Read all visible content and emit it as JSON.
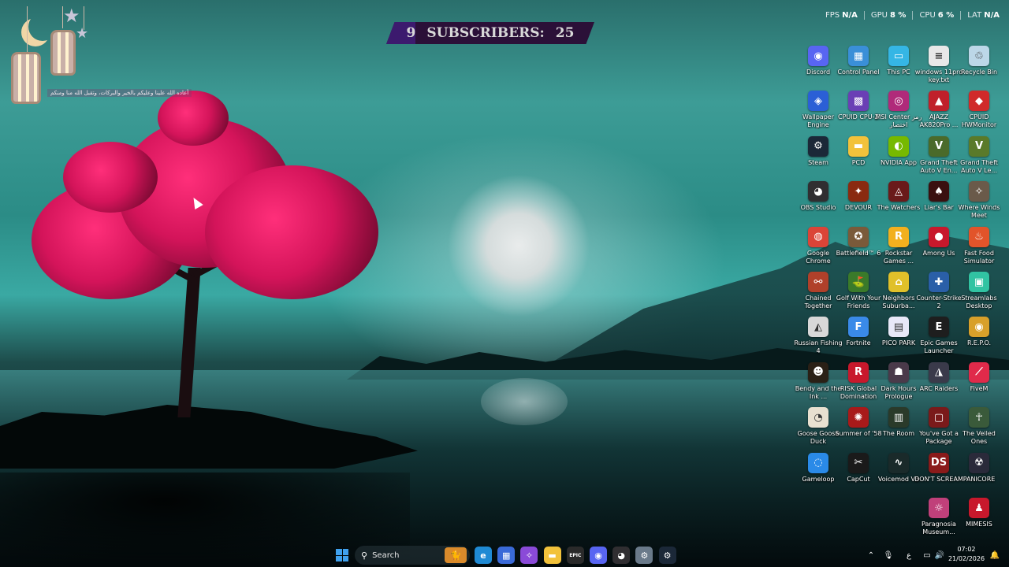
{
  "banner": {
    "count_left": "9",
    "label": "SUBSCRIBERS:",
    "count_right": "25"
  },
  "perf": [
    {
      "name": "FPS",
      "value": "N/A"
    },
    {
      "name": "GPU",
      "value": "8 %"
    },
    {
      "name": "CPU",
      "value": "6 %"
    },
    {
      "name": "LAT",
      "value": "N/A"
    }
  ],
  "decoration": {
    "arabic_text": "أعاده الله علينا وعليكم بالخير والبركات، وتقبل الله منا ومنكم"
  },
  "desktop_icons": [
    {
      "label": "Discord",
      "icon": "discord-icon",
      "color": "#5865f2",
      "glyph": "◉"
    },
    {
      "label": "Control Panel",
      "icon": "control-panel-icon",
      "color": "#3a8fd8",
      "glyph": "▦"
    },
    {
      "label": "This PC",
      "icon": "monitor-icon",
      "color": "#35b6e5",
      "glyph": "▭"
    },
    {
      "label": "windows 11pro key.txt",
      "icon": "text-file-icon",
      "color": "#e8e8e8",
      "glyph": "≡"
    },
    {
      "label": "Recycle Bin",
      "icon": "recycle-bin-icon",
      "color": "#bcd7e8",
      "glyph": "♲"
    },
    {
      "label": "Wallpaper Engine",
      "icon": "wallpaper-engine-icon",
      "color": "#2b5fd6",
      "glyph": "◈"
    },
    {
      "label": "CPUID CPU-Z",
      "icon": "cpuz-icon",
      "color": "#6a3fb5",
      "glyph": "▩"
    },
    {
      "label": "MSI Center رمز اختصار",
      "icon": "msi-center-icon",
      "color": "#b02a7a",
      "glyph": "◎"
    },
    {
      "label": "AJAZZ AK820Pro ...",
      "icon": "ajazz-icon",
      "color": "#c0202a",
      "glyph": "▲"
    },
    {
      "label": "CPUID HWMonitor",
      "icon": "hwmonitor-icon",
      "color": "#d02a2a",
      "glyph": "◆"
    },
    {
      "label": "Steam",
      "icon": "steam-icon",
      "color": "#1b2838",
      "glyph": "⚙"
    },
    {
      "label": "PCD",
      "icon": "folder-icon",
      "color": "#f2c23b",
      "glyph": "▬"
    },
    {
      "label": "NVIDIA App",
      "icon": "nvidia-icon",
      "color": "#76b900",
      "glyph": "◐"
    },
    {
      "label": "Grand Theft Auto V En...",
      "icon": "gta-icon",
      "color": "#4a6a2a",
      "glyph": "V"
    },
    {
      "label": "Grand Theft Auto V Le...",
      "icon": "gta-legacy-icon",
      "color": "#5a7a2a",
      "glyph": "V"
    },
    {
      "label": "OBS Studio",
      "icon": "obs-icon",
      "color": "#302e31",
      "glyph": "◕"
    },
    {
      "label": "DEVOUR",
      "icon": "devour-icon",
      "color": "#8a2a10",
      "glyph": "✦"
    },
    {
      "label": "The Watchers",
      "icon": "watchers-icon",
      "color": "#6a1a1a",
      "glyph": "◬"
    },
    {
      "label": "Liar's Bar",
      "icon": "liars-bar-icon",
      "color": "#3a1010",
      "glyph": "♠"
    },
    {
      "label": "Where Winds Meet",
      "icon": "where-winds-meet-icon",
      "color": "#6a5a4a",
      "glyph": "✧"
    },
    {
      "label": "Google Chrome",
      "icon": "chrome-icon",
      "color": "#db4437",
      "glyph": "◍"
    },
    {
      "label": "Battlefield™ 6",
      "icon": "battlefield-icon",
      "color": "#7a5a3a",
      "glyph": "✪"
    },
    {
      "label": "Rockstar Games ...",
      "icon": "rockstar-icon",
      "color": "#f2b01e",
      "glyph": "R"
    },
    {
      "label": "Among Us",
      "icon": "among-us-icon",
      "color": "#c8182c",
      "glyph": "●"
    },
    {
      "label": "Fast Food Simulator",
      "icon": "fast-food-icon",
      "color": "#e2542a",
      "glyph": "♨"
    },
    {
      "label": "Chained Together",
      "icon": "chained-together-icon",
      "color": "#b0402a",
      "glyph": "⚯"
    },
    {
      "label": "Golf With Your Friends",
      "icon": "golf-icon",
      "color": "#3a7a2a",
      "glyph": "⛳"
    },
    {
      "label": "Neighbors Suburba...",
      "icon": "neighbors-icon",
      "color": "#e0c02a",
      "glyph": "⌂"
    },
    {
      "label": "Counter-Strike 2",
      "icon": "counter-strike-icon",
      "color": "#2a5fa8",
      "glyph": "✚"
    },
    {
      "label": "Streamlabs Desktop",
      "icon": "streamlabs-icon",
      "color": "#31c3a2",
      "glyph": "▣"
    },
    {
      "label": "Russian Fishing 4",
      "icon": "russian-fishing-icon",
      "color": "#d8d8d8",
      "glyph": "◭"
    },
    {
      "label": "Fortnite",
      "icon": "fortnite-icon",
      "color": "#3a8ae8",
      "glyph": "F"
    },
    {
      "label": "PICO PARK",
      "icon": "pico-park-icon",
      "color": "#e8e8f8",
      "glyph": "▤"
    },
    {
      "label": "Epic Games Launcher",
      "icon": "epic-games-icon",
      "color": "#1e1e1e",
      "glyph": "E"
    },
    {
      "label": "R.E.P.O.",
      "icon": "repo-icon",
      "color": "#d8a02a",
      "glyph": "◉"
    },
    {
      "label": "Bendy and the Ink ...",
      "icon": "bendy-icon",
      "color": "#2a2016",
      "glyph": "☻"
    },
    {
      "label": "RISK Global Domination",
      "icon": "risk-icon",
      "color": "#c8182c",
      "glyph": "R"
    },
    {
      "label": "Dark Hours Prologue",
      "icon": "dark-hours-icon",
      "color": "#4a3a4a",
      "glyph": "☗"
    },
    {
      "label": "ARC Raiders",
      "icon": "arc-raiders-icon",
      "color": "#3a3a4a",
      "glyph": "◮"
    },
    {
      "label": "FiveM",
      "icon": "fivem-icon",
      "color": "#e02a4a",
      "glyph": "⟋"
    },
    {
      "label": "Goose Goose Duck",
      "icon": "goose-icon",
      "color": "#e8e0d0",
      "glyph": "◔"
    },
    {
      "label": "Summer of '58",
      "icon": "summer58-icon",
      "color": "#a81a1a",
      "glyph": "✺"
    },
    {
      "label": "The Room",
      "icon": "the-room-icon",
      "color": "#2a3a2a",
      "glyph": "▥"
    },
    {
      "label": "You've Got a Package",
      "icon": "package-icon",
      "color": "#7a1a1a",
      "glyph": "▢"
    },
    {
      "label": "The Veiled Ones",
      "icon": "veiled-ones-icon",
      "color": "#3a5a3a",
      "glyph": "☥"
    },
    {
      "label": "Gameloop",
      "icon": "gameloop-icon",
      "color": "#2a8ae8",
      "glyph": "◌"
    },
    {
      "label": "CapCut",
      "icon": "capcut-icon",
      "color": "#1a1a1a",
      "glyph": "✂"
    },
    {
      "label": "Voicemod V3",
      "icon": "voicemod-icon",
      "color": "#1a2a2a",
      "glyph": "∿"
    },
    {
      "label": "DON'T SCREAM",
      "icon": "dont-scream-icon",
      "color": "#8a1a1a",
      "glyph": "DS"
    },
    {
      "label": "PANICORE",
      "icon": "panicore-icon",
      "color": "#2a2a3a",
      "glyph": "☢"
    },
    {
      "label": "Paragnosia Museum...",
      "icon": "paragnosia-icon",
      "color": "#c0407a",
      "glyph": "☼"
    },
    {
      "label": "MIMESIS",
      "icon": "mimesis-icon",
      "color": "#c8182c",
      "glyph": "♟"
    }
  ],
  "taskbar": {
    "search_placeholder": "Search",
    "apps": [
      {
        "name": "edge-icon",
        "color": "#1f8ad4",
        "glyph": "e"
      },
      {
        "name": "store-icon",
        "color": "#3a6ad8",
        "glyph": "▦"
      },
      {
        "name": "copilot-icon",
        "color": "#8a4ad8",
        "glyph": "✧"
      },
      {
        "name": "file-explorer-icon",
        "color": "#f2c23b",
        "glyph": "▬"
      },
      {
        "name": "epic-games-taskbar-icon",
        "color": "#2a2a2a",
        "glyph": "EPIC"
      },
      {
        "name": "discord-taskbar-icon",
        "color": "#5865f2",
        "glyph": "◉"
      },
      {
        "name": "obs-taskbar-icon",
        "color": "#302e31",
        "glyph": "◕"
      },
      {
        "name": "settings-icon",
        "color": "#6a7a8a",
        "glyph": "⚙"
      },
      {
        "name": "steam-taskbar-icon",
        "color": "#1b2838",
        "glyph": "⚙"
      }
    ],
    "tray": {
      "lang": "ع",
      "time": "07:02",
      "date": "21/02/2026"
    }
  }
}
